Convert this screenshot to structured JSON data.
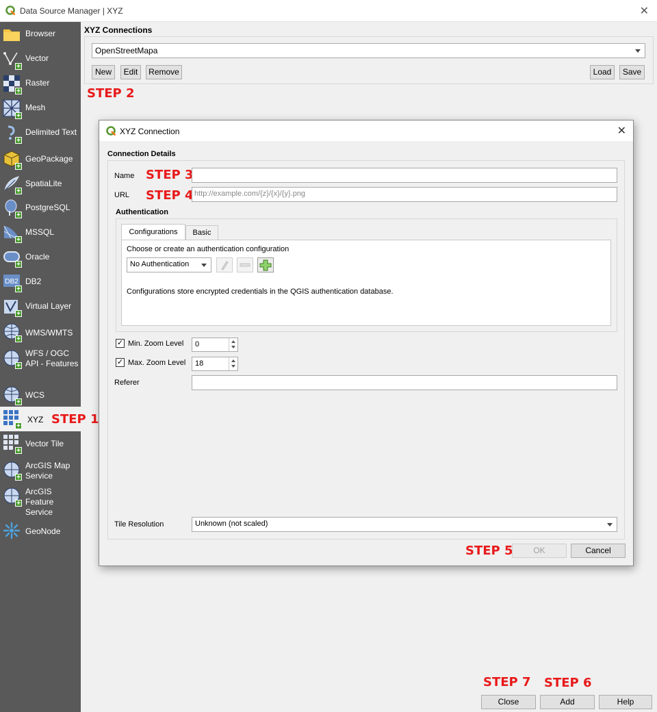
{
  "window": {
    "title": "Data Source Manager | XYZ",
    "close_glyph": "✕"
  },
  "sidebar": {
    "items": [
      {
        "label": "Browser",
        "icon": "folder-icon"
      },
      {
        "label": "Vector",
        "icon": "vector-layer-icon"
      },
      {
        "label": "Raster",
        "icon": "raster-layer-icon"
      },
      {
        "label": "Mesh",
        "icon": "mesh-layer-icon"
      },
      {
        "label": "Delimited Text",
        "icon": "delimited-text-icon"
      },
      {
        "label": "GeoPackage",
        "icon": "geopackage-icon"
      },
      {
        "label": "SpatiaLite",
        "icon": "spatialite-icon"
      },
      {
        "label": "PostgreSQL",
        "icon": "postgresql-icon"
      },
      {
        "label": "MSSQL",
        "icon": "mssql-icon"
      },
      {
        "label": "Oracle",
        "icon": "oracle-icon"
      },
      {
        "label": "DB2",
        "icon": "db2-icon",
        "icon_text": "DB2"
      },
      {
        "label": "Virtual Layer",
        "icon": "virtual-layer-icon"
      },
      {
        "label": "WMS/WMTS",
        "icon": "wms-globe-icon"
      },
      {
        "label": "WFS / OGC API - Features",
        "icon": "wfs-globe-icon"
      },
      {
        "label": "WCS",
        "icon": "wcs-globe-icon"
      },
      {
        "label": "XYZ",
        "icon": "xyz-tiles-icon"
      },
      {
        "label": "Vector Tile",
        "icon": "vector-tile-icon"
      },
      {
        "label": "ArcGIS Map Service",
        "icon": "arcgis-map-icon"
      },
      {
        "label": "ArcGIS Feature Service",
        "icon": "arcgis-feature-icon"
      },
      {
        "label": "GeoNode",
        "icon": "geonode-icon"
      }
    ],
    "active": "XYZ"
  },
  "xyz_connections": {
    "title": "XYZ Connections",
    "selected": "OpenStreetMapa",
    "buttons": {
      "new": "New",
      "edit": "Edit",
      "remove": "Remove",
      "load": "Load",
      "save": "Save"
    }
  },
  "annotations": {
    "step1": "STEP 1",
    "step2": "STEP 2",
    "step3": "STEP 3",
    "step4": "STEP 4",
    "step5": "STEP 5",
    "step6": "STEP 6",
    "step7": "STEP 7",
    "color": "#e8191a"
  },
  "dialog": {
    "title": "XYZ Connection",
    "close_glyph": "✕",
    "connection_details": "Connection Details",
    "name_label": "Name",
    "name_value": "",
    "url_label": "URL",
    "url_placeholder": "http://example.com/{z}/{x}/{y}.png",
    "authentication": "Authentication",
    "tabs": [
      "Configurations",
      "Basic"
    ],
    "choose_text": "Choose or create an authentication configuration",
    "auth_select": "No Authentication",
    "auth_note": "Configurations store encrypted credentials in the QGIS authentication database.",
    "min_zoom_label": "Min. Zoom Level",
    "min_zoom_value": "0",
    "max_zoom_label": "Max. Zoom Level",
    "max_zoom_value": "18",
    "referer_label": "Referer",
    "tile_resolution_label": "Tile Resolution",
    "tile_resolution_value": "Unknown (not scaled)",
    "ok": "OK",
    "cancel": "Cancel"
  },
  "footer": {
    "close": "Close",
    "add": "Add",
    "help": "Help"
  }
}
